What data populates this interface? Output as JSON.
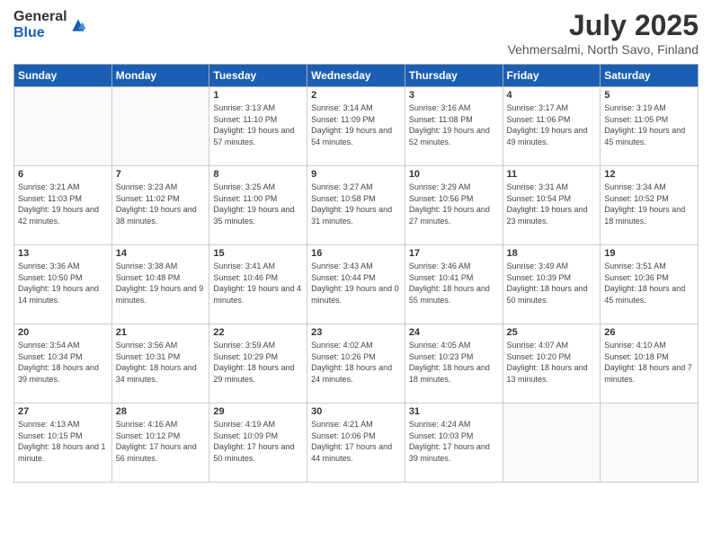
{
  "logo": {
    "general": "General",
    "blue": "Blue"
  },
  "title": "July 2025",
  "subtitle": "Vehmersalmi, North Savo, Finland",
  "headers": [
    "Sunday",
    "Monday",
    "Tuesday",
    "Wednesday",
    "Thursday",
    "Friday",
    "Saturday"
  ],
  "weeks": [
    [
      {
        "num": "",
        "info": ""
      },
      {
        "num": "",
        "info": ""
      },
      {
        "num": "1",
        "info": "Sunrise: 3:13 AM\nSunset: 11:10 PM\nDaylight: 19 hours and 57 minutes."
      },
      {
        "num": "2",
        "info": "Sunrise: 3:14 AM\nSunset: 11:09 PM\nDaylight: 19 hours and 54 minutes."
      },
      {
        "num": "3",
        "info": "Sunrise: 3:16 AM\nSunset: 11:08 PM\nDaylight: 19 hours and 52 minutes."
      },
      {
        "num": "4",
        "info": "Sunrise: 3:17 AM\nSunset: 11:06 PM\nDaylight: 19 hours and 49 minutes."
      },
      {
        "num": "5",
        "info": "Sunrise: 3:19 AM\nSunset: 11:05 PM\nDaylight: 19 hours and 45 minutes."
      }
    ],
    [
      {
        "num": "6",
        "info": "Sunrise: 3:21 AM\nSunset: 11:03 PM\nDaylight: 19 hours and 42 minutes."
      },
      {
        "num": "7",
        "info": "Sunrise: 3:23 AM\nSunset: 11:02 PM\nDaylight: 19 hours and 38 minutes."
      },
      {
        "num": "8",
        "info": "Sunrise: 3:25 AM\nSunset: 11:00 PM\nDaylight: 19 hours and 35 minutes."
      },
      {
        "num": "9",
        "info": "Sunrise: 3:27 AM\nSunset: 10:58 PM\nDaylight: 19 hours and 31 minutes."
      },
      {
        "num": "10",
        "info": "Sunrise: 3:29 AM\nSunset: 10:56 PM\nDaylight: 19 hours and 27 minutes."
      },
      {
        "num": "11",
        "info": "Sunrise: 3:31 AM\nSunset: 10:54 PM\nDaylight: 19 hours and 23 minutes."
      },
      {
        "num": "12",
        "info": "Sunrise: 3:34 AM\nSunset: 10:52 PM\nDaylight: 19 hours and 18 minutes."
      }
    ],
    [
      {
        "num": "13",
        "info": "Sunrise: 3:36 AM\nSunset: 10:50 PM\nDaylight: 19 hours and 14 minutes."
      },
      {
        "num": "14",
        "info": "Sunrise: 3:38 AM\nSunset: 10:48 PM\nDaylight: 19 hours and 9 minutes."
      },
      {
        "num": "15",
        "info": "Sunrise: 3:41 AM\nSunset: 10:46 PM\nDaylight: 19 hours and 4 minutes."
      },
      {
        "num": "16",
        "info": "Sunrise: 3:43 AM\nSunset: 10:44 PM\nDaylight: 19 hours and 0 minutes."
      },
      {
        "num": "17",
        "info": "Sunrise: 3:46 AM\nSunset: 10:41 PM\nDaylight: 18 hours and 55 minutes."
      },
      {
        "num": "18",
        "info": "Sunrise: 3:49 AM\nSunset: 10:39 PM\nDaylight: 18 hours and 50 minutes."
      },
      {
        "num": "19",
        "info": "Sunrise: 3:51 AM\nSunset: 10:36 PM\nDaylight: 18 hours and 45 minutes."
      }
    ],
    [
      {
        "num": "20",
        "info": "Sunrise: 3:54 AM\nSunset: 10:34 PM\nDaylight: 18 hours and 39 minutes."
      },
      {
        "num": "21",
        "info": "Sunrise: 3:56 AM\nSunset: 10:31 PM\nDaylight: 18 hours and 34 minutes."
      },
      {
        "num": "22",
        "info": "Sunrise: 3:59 AM\nSunset: 10:29 PM\nDaylight: 18 hours and 29 minutes."
      },
      {
        "num": "23",
        "info": "Sunrise: 4:02 AM\nSunset: 10:26 PM\nDaylight: 18 hours and 24 minutes."
      },
      {
        "num": "24",
        "info": "Sunrise: 4:05 AM\nSunset: 10:23 PM\nDaylight: 18 hours and 18 minutes."
      },
      {
        "num": "25",
        "info": "Sunrise: 4:07 AM\nSunset: 10:20 PM\nDaylight: 18 hours and 13 minutes."
      },
      {
        "num": "26",
        "info": "Sunrise: 4:10 AM\nSunset: 10:18 PM\nDaylight: 18 hours and 7 minutes."
      }
    ],
    [
      {
        "num": "27",
        "info": "Sunrise: 4:13 AM\nSunset: 10:15 PM\nDaylight: 18 hours and 1 minute."
      },
      {
        "num": "28",
        "info": "Sunrise: 4:16 AM\nSunset: 10:12 PM\nDaylight: 17 hours and 56 minutes."
      },
      {
        "num": "29",
        "info": "Sunrise: 4:19 AM\nSunset: 10:09 PM\nDaylight: 17 hours and 50 minutes."
      },
      {
        "num": "30",
        "info": "Sunrise: 4:21 AM\nSunset: 10:06 PM\nDaylight: 17 hours and 44 minutes."
      },
      {
        "num": "31",
        "info": "Sunrise: 4:24 AM\nSunset: 10:03 PM\nDaylight: 17 hours and 39 minutes."
      },
      {
        "num": "",
        "info": ""
      },
      {
        "num": "",
        "info": ""
      }
    ]
  ]
}
